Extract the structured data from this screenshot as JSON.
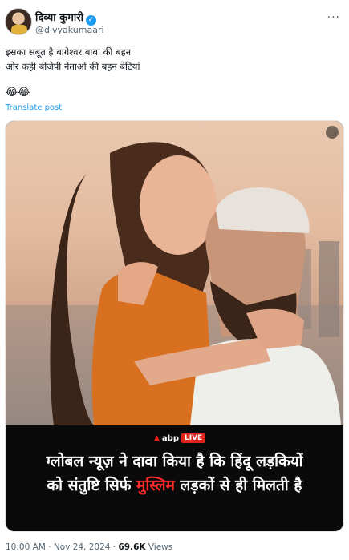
{
  "post": {
    "author": {
      "display_name": "दिव्या कुमारी",
      "verified_icon": "✓",
      "handle": "@divyakumaari"
    },
    "more_icon": "···",
    "text_lines": [
      "इसका सबूत है बागेश्वर बाबा की बहन",
      "ओर कही बीजेपी नेताओं की बहन बेटियां"
    ],
    "emojis": "😂😂",
    "translate_label": "Translate post",
    "media": {
      "badge_mark": "▲",
      "badge_brand": "abp",
      "badge_live": "LIVE",
      "headline_line1": "ग्लोबल न्यूज़ ने दावा किया है कि हिंदू लड़कियों",
      "headline_line2_pre": "को संतुष्टि सिर्फ ",
      "headline_line2_highlight": "मुस्लिम",
      "headline_line2_post": " लड़कों से ही मिलती है",
      "highlight_color": "#ff2a2a"
    },
    "meta": {
      "time": "10:00 AM",
      "separator": " · ",
      "date": "Nov 24, 2024",
      "views_count": "69.6K",
      "views_label": " Views"
    }
  }
}
